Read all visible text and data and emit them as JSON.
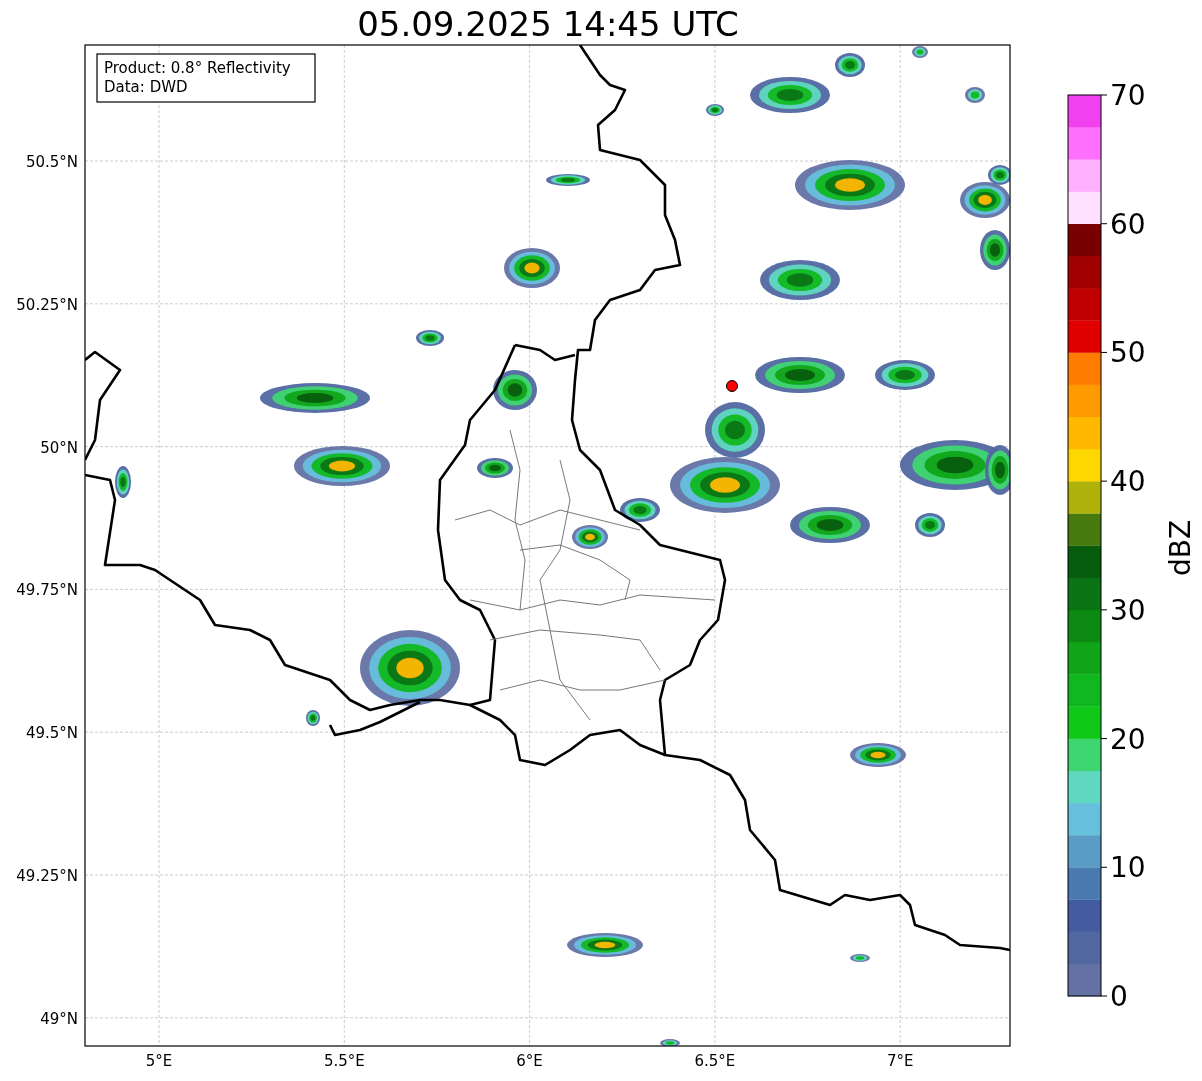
{
  "title": "05.09.2025 14:45 UTC",
  "info_box": [
    "Product: 0.8° Reflectivity",
    "Data: DWD"
  ],
  "lat_ticks": [
    "50.5°N",
    "50.25°N",
    "50°N",
    "49.75°N",
    "49.5°N",
    "49.25°N",
    "49°N"
  ],
  "lon_ticks": [
    "5°E",
    "5.5°E",
    "6°E",
    "6.5°E",
    "7°E"
  ],
  "colorbar": {
    "label": "dBZ",
    "ticks": [
      "70",
      "60",
      "50",
      "40",
      "30",
      "20",
      "10",
      "0"
    ],
    "segments": [
      {
        "color": "#6371a5"
      },
      {
        "color": "#5067a0"
      },
      {
        "color": "#425c9f"
      },
      {
        "color": "#4a7ab0"
      },
      {
        "color": "#5a9cc6"
      },
      {
        "color": "#66c0dc"
      },
      {
        "color": "#60d8c0"
      },
      {
        "color": "#3ed670"
      },
      {
        "color": "#10c818"
      },
      {
        "color": "#10b820"
      },
      {
        "color": "#10a418"
      },
      {
        "color": "#0c8a14"
      },
      {
        "color": "#0a7414"
      },
      {
        "color": "#075c0e"
      },
      {
        "color": "#467a0e"
      },
      {
        "color": "#aeb20a"
      },
      {
        "color": "#ffd700"
      },
      {
        "color": "#ffb800"
      },
      {
        "color": "#ff9a00"
      },
      {
        "color": "#ff7c00"
      },
      {
        "color": "#e00000"
      },
      {
        "color": "#c00000"
      },
      {
        "color": "#a00000"
      },
      {
        "color": "#780000"
      },
      {
        "color": "#ffe0ff"
      },
      {
        "color": "#ffb0ff"
      },
      {
        "color": "#ff70ff"
      },
      {
        "color": "#f040f0"
      }
    ]
  }
}
